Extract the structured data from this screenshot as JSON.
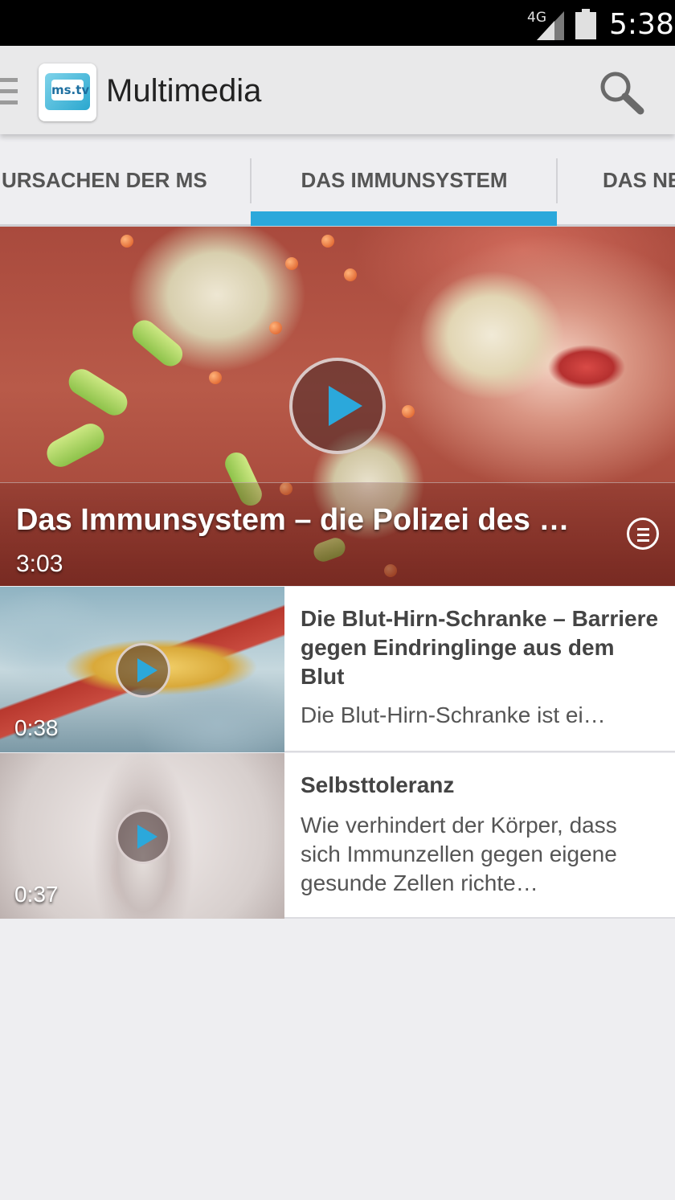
{
  "status_bar": {
    "network": "4G",
    "time": "5:38"
  },
  "action_bar": {
    "logo_text": "ms.tv",
    "title": "Multimedia"
  },
  "tabs": [
    {
      "label": "URSACHEN DER MS",
      "selected": false
    },
    {
      "label": "DAS IMMUNSYSTEM",
      "selected": true
    },
    {
      "label": "DAS NE",
      "selected": false
    }
  ],
  "accent_color": "#2ba8db",
  "featured": {
    "title": "Das Immunsystem – die Polizei des …",
    "duration": "3:03"
  },
  "videos": [
    {
      "title": "Die Blut-Hirn-Schranke – Barriere gegen Eindringlinge aus dem Blut",
      "description": "Die Blut-Hirn-Schranke ist ei…",
      "duration": "0:38"
    },
    {
      "title": "Selbsttoleranz",
      "description": "Wie  verhindert der Körper, dass sich Immunzellen gegen eigene gesunde Zellen richte…",
      "duration": "0:37"
    }
  ]
}
